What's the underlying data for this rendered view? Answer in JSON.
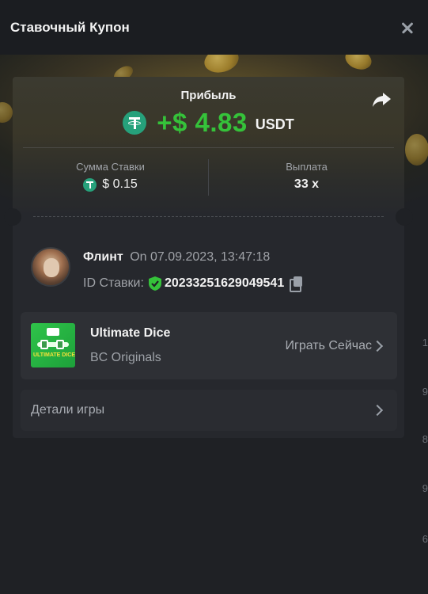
{
  "header": {
    "title": "Ставочный Купон"
  },
  "coupon": {
    "profit_label": "Прибыль",
    "profit_amount": "+$ 4.83",
    "profit_currency": "USDT",
    "bet_amount_label": "Сумма Ставки",
    "bet_amount_value": "$ 0.15",
    "payout_label": "Выплата",
    "payout_value": "33 x"
  },
  "user": {
    "name": "Флинт",
    "date": "On 07.09.2023, 13:47:18",
    "bet_id_label": "ID Ставки:",
    "bet_id": "20233251629049541"
  },
  "game": {
    "title": "Ultimate Dice",
    "provider": "BC Originals",
    "play_label": "Играть Сейчас",
    "thumb_text": "ULTIMATE DICE"
  },
  "details": {
    "label": "Детали игры"
  },
  "colors": {
    "profit_green": "#35c23a",
    "tether_green": "#26a17b",
    "background": "#1f2125",
    "card": "#26282d"
  },
  "icons": {
    "close": "close-icon",
    "share": "share-icon",
    "currency": "tether-icon",
    "verified": "shield-check-icon",
    "copy": "copy-icon",
    "chevron": "chevron-right-icon"
  }
}
